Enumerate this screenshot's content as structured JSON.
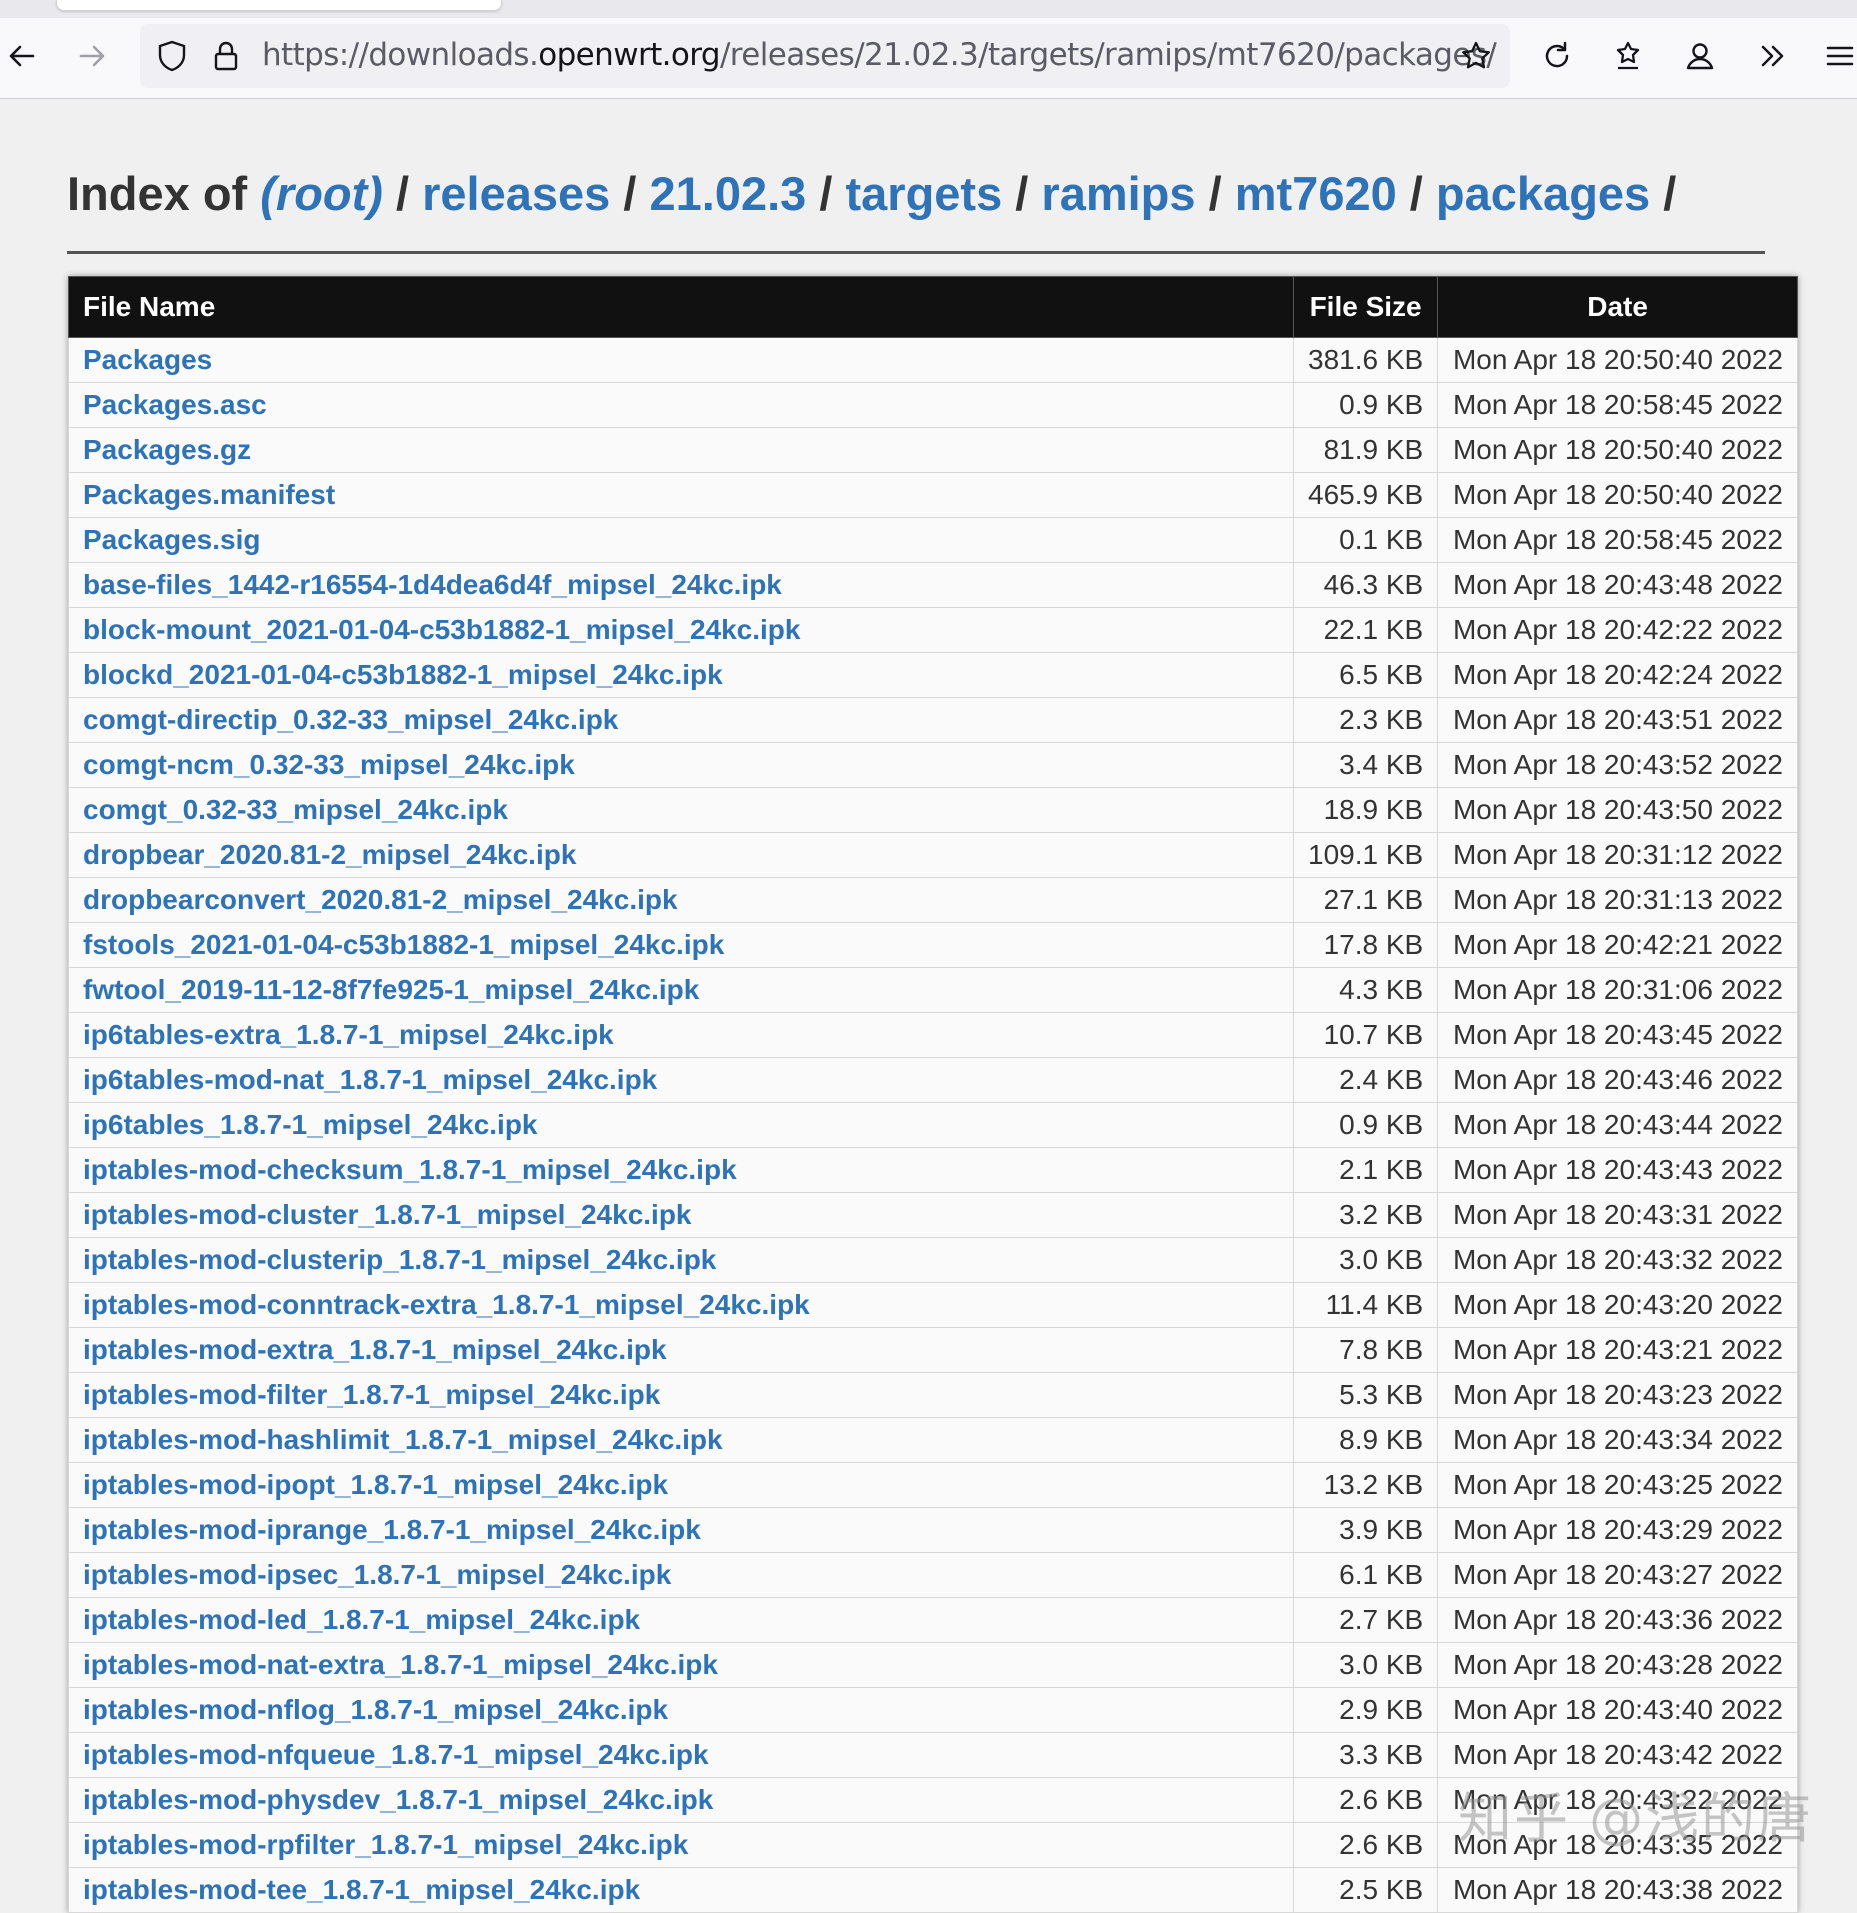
{
  "browser": {
    "url_prefix": "https://downloads.",
    "url_host": "openwrt.org",
    "url_path": "/releases/21.02.3/targets/ramips/mt7620/packages/"
  },
  "heading": {
    "prefix": "Index of",
    "root": "(root)",
    "sep": "/",
    "crumbs": [
      "releases",
      "21.02.3",
      "targets",
      "ramips",
      "mt7620",
      "packages"
    ]
  },
  "table": {
    "headers": {
      "name": "File Name",
      "size": "File Size",
      "date": "Date"
    },
    "rows": [
      {
        "name": "Packages",
        "size": "381.6 KB",
        "date": "Mon Apr 18 20:50:40 2022"
      },
      {
        "name": "Packages.asc",
        "size": "0.9 KB",
        "date": "Mon Apr 18 20:58:45 2022"
      },
      {
        "name": "Packages.gz",
        "size": "81.9 KB",
        "date": "Mon Apr 18 20:50:40 2022"
      },
      {
        "name": "Packages.manifest",
        "size": "465.9 KB",
        "date": "Mon Apr 18 20:50:40 2022"
      },
      {
        "name": "Packages.sig",
        "size": "0.1 KB",
        "date": "Mon Apr 18 20:58:45 2022"
      },
      {
        "name": "base-files_1442-r16554-1d4dea6d4f_mipsel_24kc.ipk",
        "size": "46.3 KB",
        "date": "Mon Apr 18 20:43:48 2022"
      },
      {
        "name": "block-mount_2021-01-04-c53b1882-1_mipsel_24kc.ipk",
        "size": "22.1 KB",
        "date": "Mon Apr 18 20:42:22 2022"
      },
      {
        "name": "blockd_2021-01-04-c53b1882-1_mipsel_24kc.ipk",
        "size": "6.5 KB",
        "date": "Mon Apr 18 20:42:24 2022"
      },
      {
        "name": "comgt-directip_0.32-33_mipsel_24kc.ipk",
        "size": "2.3 KB",
        "date": "Mon Apr 18 20:43:51 2022"
      },
      {
        "name": "comgt-ncm_0.32-33_mipsel_24kc.ipk",
        "size": "3.4 KB",
        "date": "Mon Apr 18 20:43:52 2022"
      },
      {
        "name": "comgt_0.32-33_mipsel_24kc.ipk",
        "size": "18.9 KB",
        "date": "Mon Apr 18 20:43:50 2022"
      },
      {
        "name": "dropbear_2020.81-2_mipsel_24kc.ipk",
        "size": "109.1 KB",
        "date": "Mon Apr 18 20:31:12 2022"
      },
      {
        "name": "dropbearconvert_2020.81-2_mipsel_24kc.ipk",
        "size": "27.1 KB",
        "date": "Mon Apr 18 20:31:13 2022"
      },
      {
        "name": "fstools_2021-01-04-c53b1882-1_mipsel_24kc.ipk",
        "size": "17.8 KB",
        "date": "Mon Apr 18 20:42:21 2022"
      },
      {
        "name": "fwtool_2019-11-12-8f7fe925-1_mipsel_24kc.ipk",
        "size": "4.3 KB",
        "date": "Mon Apr 18 20:31:06 2022"
      },
      {
        "name": "ip6tables-extra_1.8.7-1_mipsel_24kc.ipk",
        "size": "10.7 KB",
        "date": "Mon Apr 18 20:43:45 2022"
      },
      {
        "name": "ip6tables-mod-nat_1.8.7-1_mipsel_24kc.ipk",
        "size": "2.4 KB",
        "date": "Mon Apr 18 20:43:46 2022"
      },
      {
        "name": "ip6tables_1.8.7-1_mipsel_24kc.ipk",
        "size": "0.9 KB",
        "date": "Mon Apr 18 20:43:44 2022"
      },
      {
        "name": "iptables-mod-checksum_1.8.7-1_mipsel_24kc.ipk",
        "size": "2.1 KB",
        "date": "Mon Apr 18 20:43:43 2022"
      },
      {
        "name": "iptables-mod-cluster_1.8.7-1_mipsel_24kc.ipk",
        "size": "3.2 KB",
        "date": "Mon Apr 18 20:43:31 2022"
      },
      {
        "name": "iptables-mod-clusterip_1.8.7-1_mipsel_24kc.ipk",
        "size": "3.0 KB",
        "date": "Mon Apr 18 20:43:32 2022"
      },
      {
        "name": "iptables-mod-conntrack-extra_1.8.7-1_mipsel_24kc.ipk",
        "size": "11.4 KB",
        "date": "Mon Apr 18 20:43:20 2022"
      },
      {
        "name": "iptables-mod-extra_1.8.7-1_mipsel_24kc.ipk",
        "size": "7.8 KB",
        "date": "Mon Apr 18 20:43:21 2022"
      },
      {
        "name": "iptables-mod-filter_1.8.7-1_mipsel_24kc.ipk",
        "size": "5.3 KB",
        "date": "Mon Apr 18 20:43:23 2022"
      },
      {
        "name": "iptables-mod-hashlimit_1.8.7-1_mipsel_24kc.ipk",
        "size": "8.9 KB",
        "date": "Mon Apr 18 20:43:34 2022"
      },
      {
        "name": "iptables-mod-ipopt_1.8.7-1_mipsel_24kc.ipk",
        "size": "13.2 KB",
        "date": "Mon Apr 18 20:43:25 2022"
      },
      {
        "name": "iptables-mod-iprange_1.8.7-1_mipsel_24kc.ipk",
        "size": "3.9 KB",
        "date": "Mon Apr 18 20:43:29 2022"
      },
      {
        "name": "iptables-mod-ipsec_1.8.7-1_mipsel_24kc.ipk",
        "size": "6.1 KB",
        "date": "Mon Apr 18 20:43:27 2022"
      },
      {
        "name": "iptables-mod-led_1.8.7-1_mipsel_24kc.ipk",
        "size": "2.7 KB",
        "date": "Mon Apr 18 20:43:36 2022"
      },
      {
        "name": "iptables-mod-nat-extra_1.8.7-1_mipsel_24kc.ipk",
        "size": "3.0 KB",
        "date": "Mon Apr 18 20:43:28 2022"
      },
      {
        "name": "iptables-mod-nflog_1.8.7-1_mipsel_24kc.ipk",
        "size": "2.9 KB",
        "date": "Mon Apr 18 20:43:40 2022"
      },
      {
        "name": "iptables-mod-nfqueue_1.8.7-1_mipsel_24kc.ipk",
        "size": "3.3 KB",
        "date": "Mon Apr 18 20:43:42 2022"
      },
      {
        "name": "iptables-mod-physdev_1.8.7-1_mipsel_24kc.ipk",
        "size": "2.6 KB",
        "date": "Mon Apr 18 20:43:22 2022"
      },
      {
        "name": "iptables-mod-rpfilter_1.8.7-1_mipsel_24kc.ipk",
        "size": "2.6 KB",
        "date": "Mon Apr 18 20:43:35 2022"
      },
      {
        "name": "iptables-mod-tee_1.8.7-1_mipsel_24kc.ipk",
        "size": "2.5 KB",
        "date": "Mon Apr 18 20:43:38 2022"
      }
    ]
  },
  "watermark": "知乎 @浅的唐",
  "icons": {
    "back": "back-arrow-icon",
    "forward": "forward-arrow-icon",
    "shield": "shield-icon",
    "lock": "lock-icon",
    "star": "star-icon",
    "reload": "reload-icon",
    "extensions": "extensions-icon",
    "account": "account-icon",
    "overflow": "overflow-chevron-icon",
    "menu": "menu-icon"
  },
  "colors": {
    "link": "#2e72b8",
    "header_bg": "#111111",
    "page_bg": "#f0f0f0"
  }
}
